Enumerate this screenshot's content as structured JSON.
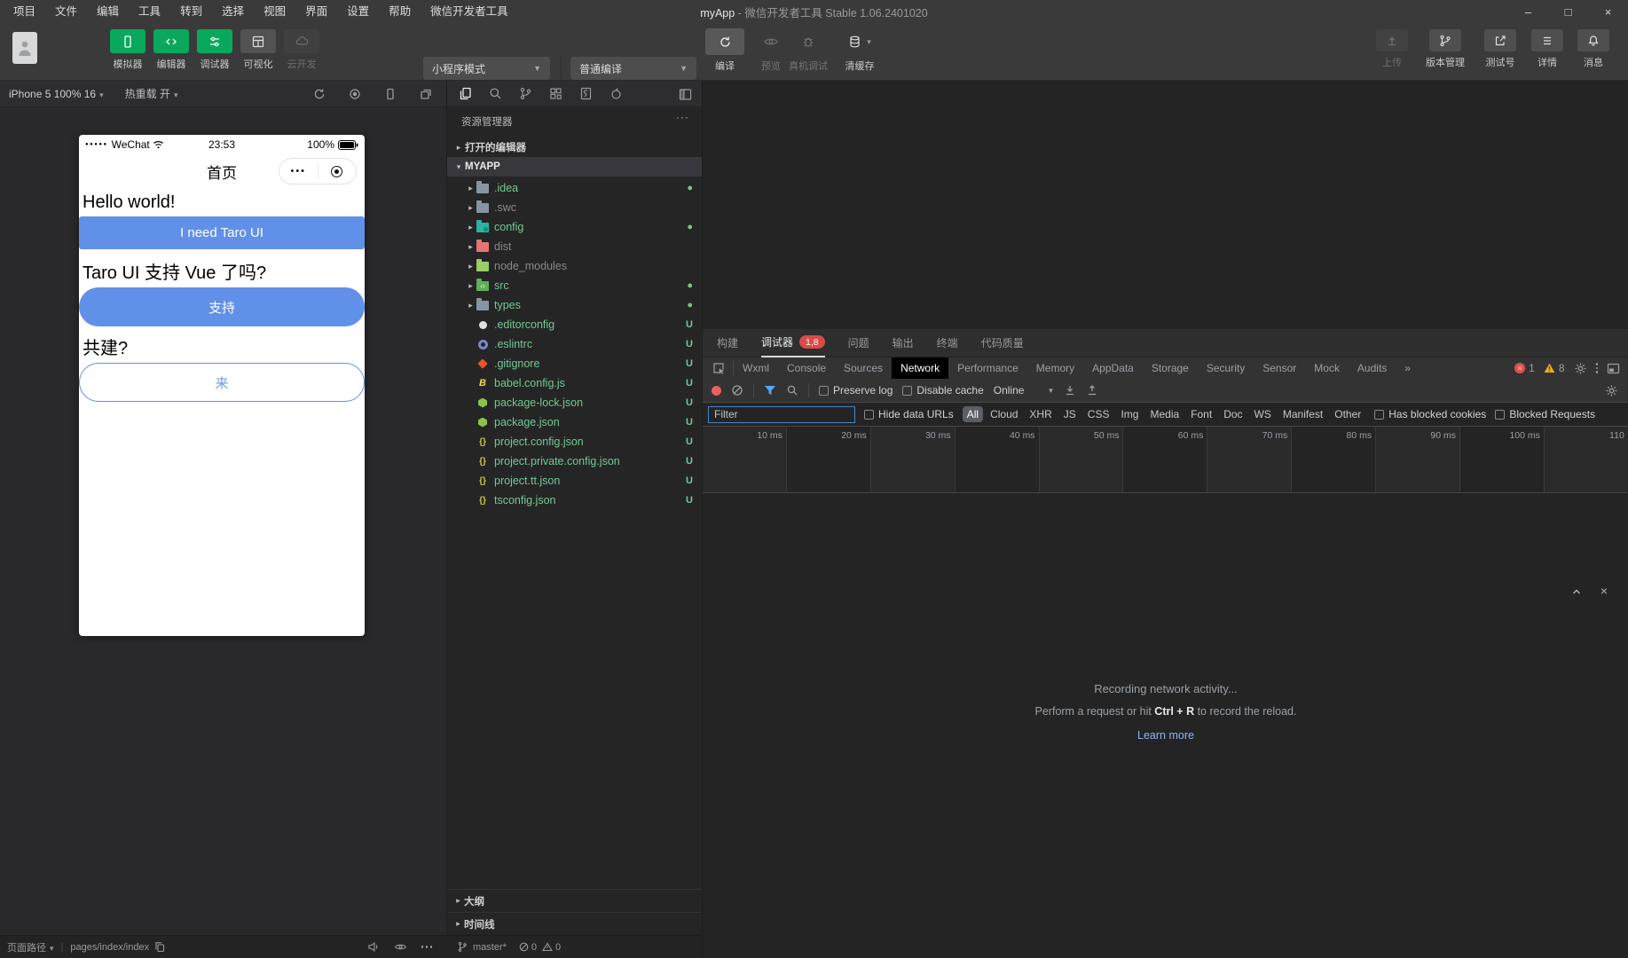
{
  "win": {
    "title_app": "myApp",
    "title_rest": "-  微信开发者工具 Stable 1.06.2401020",
    "minimize": "–",
    "maximize": "□",
    "close": "×"
  },
  "menu": {
    "items": [
      "项目",
      "文件",
      "编辑",
      "工具",
      "转到",
      "选择",
      "视图",
      "界面",
      "设置",
      "帮助",
      "微信开发者工具"
    ]
  },
  "toolbar": {
    "simulator": "模拟器",
    "editor": "编辑器",
    "debugger": "调试器",
    "visual": "可视化",
    "cloud": "云开发",
    "mode_select": "小程序模式",
    "compile_select": "普通编译",
    "compile": "编译",
    "preview": "预览",
    "device_debug": "真机调试",
    "clear_cache": "清缓存",
    "upload": "上传",
    "version": "版本管理",
    "test_account": "测试号",
    "details": "详情",
    "messages": "消息"
  },
  "sim": {
    "device_select": "iPhone 5 100% 16",
    "hot_reload": "热重载 开",
    "phone": {
      "signal": "●●●●●",
      "carrier": "WeChat",
      "time": "23:53",
      "battery_pct": "100%",
      "nav_title": "首页",
      "capsule_dots": "•••",
      "hello": "Hello world!",
      "btn_need": "I need Taro UI",
      "q_vue": "Taro UI 支持 Vue 了吗?",
      "btn_support": "支持",
      "q_build": "共建?",
      "btn_come": "来"
    },
    "footer": {
      "page_path_label": "页面路径",
      "page_path": "pages/index/index"
    }
  },
  "explorer": {
    "title": "资源管理器",
    "open_editors": "打开的编辑器",
    "project": "MYAPP",
    "tree": [
      {
        "name": ".idea",
        "cls": "t-green",
        "icon": "fico f-gray",
        "arrow": "▸",
        "marker": "●"
      },
      {
        "name": ".swc",
        "cls": "t-gray",
        "icon": "fico f-gray",
        "arrow": "▸",
        "marker": ""
      },
      {
        "name": "config",
        "cls": "t-green",
        "icon": "fico f-teal",
        "arrow": "▸",
        "marker": "●"
      },
      {
        "name": "dist",
        "cls": "t-gray",
        "icon": "fico f-red",
        "arrow": "▸",
        "marker": ""
      },
      {
        "name": "node_modules",
        "cls": "t-gray",
        "icon": "fico f-green",
        "arrow": "▸",
        "marker": ""
      },
      {
        "name": "src",
        "cls": "t-green",
        "icon": "fico f-src",
        "arrow": "▸",
        "marker": "●"
      },
      {
        "name": "types",
        "cls": "t-green",
        "icon": "fico f-gray",
        "arrow": "▸",
        "marker": "●"
      },
      {
        "name": ".editorconfig",
        "cls": "t-green",
        "icon": "ficn i-editorconfig",
        "arrow": "",
        "marker": "U"
      },
      {
        "name": ".eslintrc",
        "cls": "t-green",
        "icon": "ficn i-eslint",
        "arrow": "",
        "marker": "U"
      },
      {
        "name": ".gitignore",
        "cls": "t-green",
        "icon": "ficn i-git",
        "arrow": "",
        "marker": "U"
      },
      {
        "name": "babel.config.js",
        "cls": "t-green",
        "icon": "ficn i-babel",
        "arrow": "",
        "marker": "U"
      },
      {
        "name": "package-lock.json",
        "cls": "t-green",
        "icon": "ficn i-npm",
        "arrow": "",
        "marker": "U"
      },
      {
        "name": "package.json",
        "cls": "t-green",
        "icon": "ficn i-npm",
        "arrow": "",
        "marker": "U"
      },
      {
        "name": "project.config.json",
        "cls": "t-green",
        "icon": "ficn i-braces",
        "arrow": "",
        "marker": "U"
      },
      {
        "name": "project.private.config.json",
        "cls": "t-green",
        "icon": "ficn i-braces",
        "arrow": "",
        "marker": "U"
      },
      {
        "name": "project.tt.json",
        "cls": "t-green",
        "icon": "ficn i-braces",
        "arrow": "",
        "marker": "U"
      },
      {
        "name": "tsconfig.json",
        "cls": "t-green",
        "icon": "ficn i-braces",
        "arrow": "",
        "marker": "U"
      }
    ],
    "outline": "大纲",
    "timeline": "时间线",
    "footer": {
      "branch": "master*",
      "errors": "0",
      "warnings": "0"
    }
  },
  "dbg": {
    "tabs": [
      {
        "label": "构建",
        "cls": "",
        "badge": ""
      },
      {
        "label": "调试器",
        "cls": "active",
        "badge": "1,8"
      },
      {
        "label": "问题",
        "cls": "",
        "badge": ""
      },
      {
        "label": "输出",
        "cls": "",
        "badge": ""
      },
      {
        "label": "终端",
        "cls": "",
        "badge": ""
      },
      {
        "label": "代码质量",
        "cls": "",
        "badge": ""
      }
    ],
    "dt_tabs": [
      {
        "label": "Wxml",
        "cls": ""
      },
      {
        "label": "Console",
        "cls": ""
      },
      {
        "label": "Sources",
        "cls": ""
      },
      {
        "label": "Network",
        "cls": "active"
      },
      {
        "label": "Performance",
        "cls": ""
      },
      {
        "label": "Memory",
        "cls": ""
      },
      {
        "label": "AppData",
        "cls": ""
      },
      {
        "label": "Storage",
        "cls": ""
      },
      {
        "label": "Security",
        "cls": ""
      },
      {
        "label": "Sensor",
        "cls": ""
      },
      {
        "label": "Mock",
        "cls": ""
      },
      {
        "label": "Audits",
        "cls": ""
      },
      {
        "label": "»",
        "cls": ""
      }
    ],
    "err_count": "1",
    "warn_count": "8",
    "net": {
      "preserve_log": "Preserve log",
      "disable_cache": "Disable cache",
      "throttle": "Online",
      "filter_placeholder": "Filter",
      "hide_data_urls": "Hide data URLs",
      "type_filters": [
        {
          "label": "All",
          "cls": "active"
        },
        {
          "label": "Cloud",
          "cls": ""
        },
        {
          "label": "XHR",
          "cls": ""
        },
        {
          "label": "JS",
          "cls": ""
        },
        {
          "label": "CSS",
          "cls": ""
        },
        {
          "label": "Img",
          "cls": ""
        },
        {
          "label": "Media",
          "cls": ""
        },
        {
          "label": "Font",
          "cls": ""
        },
        {
          "label": "Doc",
          "cls": ""
        },
        {
          "label": "WS",
          "cls": ""
        },
        {
          "label": "Manifest",
          "cls": ""
        },
        {
          "label": "Other",
          "cls": ""
        }
      ],
      "has_blocked_cookies": "Has blocked cookies",
      "blocked_requests": "Blocked Requests",
      "ticks": [
        "10 ms",
        "20 ms",
        "30 ms",
        "40 ms",
        "50 ms",
        "60 ms",
        "70 ms",
        "80 ms",
        "90 ms",
        "100 ms",
        "110"
      ],
      "message_title": "Recording network activity...",
      "message_pre": "Perform a request or hit ",
      "key_ctrl": "Ctrl",
      "key_plus": " + ",
      "key_r": "R",
      "message_post": " to record the reload.",
      "learn_more": "Learn more"
    }
  }
}
